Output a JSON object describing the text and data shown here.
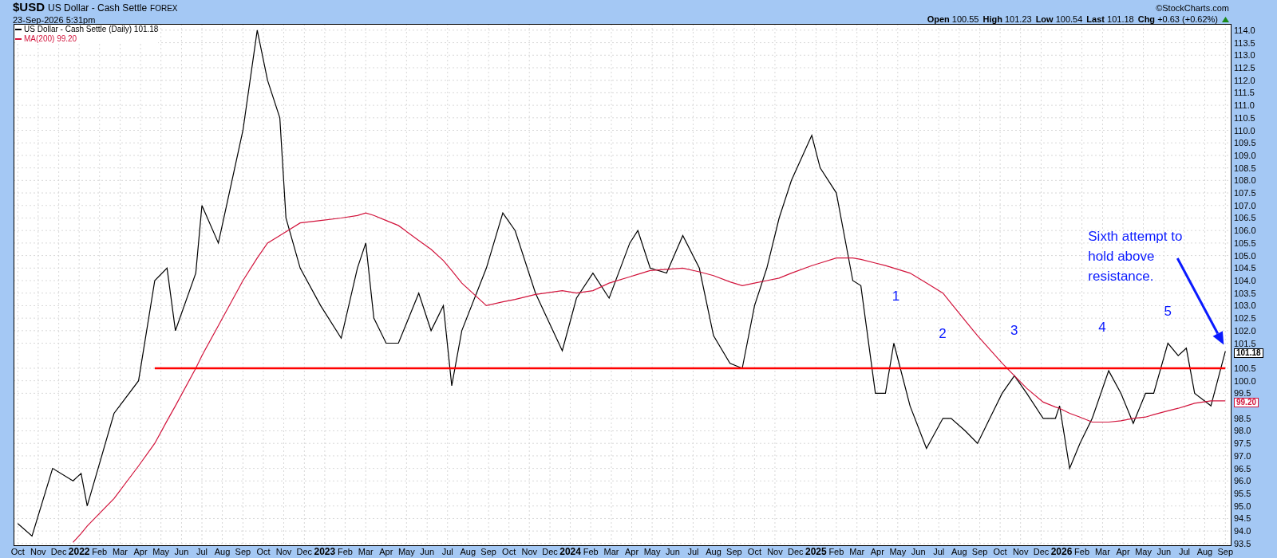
{
  "header": {
    "symbol": "$USD",
    "name": "US Dollar - Cash Settle",
    "exchange": "FOREX",
    "timestamp": "23-Sep-2026 5:31pm",
    "copyright": "©StockCharts.com",
    "quote": [
      {
        "label": "Open",
        "value": "100.55"
      },
      {
        "label": "High",
        "value": "101.23"
      },
      {
        "label": "Low",
        "value": "100.54"
      },
      {
        "label": "Last",
        "value": "101.18"
      },
      {
        "label": "Chg",
        "value": "+0.63 (+0.62%)"
      }
    ],
    "change_up": true
  },
  "legend_readings": [
    "101.18",
    "99.20"
  ],
  "price_tags": [
    "101.18",
    "99.20"
  ],
  "chart": {
    "chart_data": {
      "type": "line",
      "grid": true,
      "legend": true,
      "xlim": [
        2021.733,
        2026.692
      ],
      "ylim": [
        93.4,
        114.25
      ],
      "x": [
        2021.75,
        2021.808,
        2021.892,
        2021.975,
        2022.008,
        2022.033,
        2022.142,
        2022.242,
        2022.308,
        2022.358,
        2022.392,
        2022.475,
        2022.5,
        2022.567,
        2022.667,
        2022.725,
        2022.767,
        2022.817,
        2022.842,
        2022.9,
        2022.983,
        2023.067,
        2023.133,
        2023.167,
        2023.2,
        2023.25,
        2023.3,
        2023.383,
        2023.433,
        2023.483,
        2023.517,
        2023.558,
        2023.658,
        2023.725,
        2023.775,
        2023.858,
        2023.967,
        2024.025,
        2024.092,
        2024.158,
        2024.242,
        2024.275,
        2024.325,
        2024.392,
        2024.458,
        2024.525,
        2024.583,
        2024.65,
        2024.7,
        2024.75,
        2024.8,
        2024.85,
        2024.9,
        2024.983,
        2025.017,
        2025.083,
        2025.15,
        2025.183,
        2025.242,
        2025.283,
        2025.317,
        2025.383,
        2025.45,
        2025.517,
        2025.55,
        2025.608,
        2025.658,
        2025.708,
        2025.758,
        2025.808,
        2025.858,
        2025.925,
        2025.975,
        2025.992,
        2026.033,
        2026.075,
        2026.125,
        2026.192,
        2026.242,
        2026.292,
        2026.342,
        2026.375,
        2026.433,
        2026.475,
        2026.508,
        2026.542,
        2026.608,
        2026.667
      ],
      "series": [
        {
          "name": "US Dollar - Cash Settle (Daily)",
          "color": "#000000",
          "values": [
            94.3,
            93.8,
            96.5,
            96.0,
            96.3,
            95.0,
            98.7,
            100.0,
            104.0,
            104.5,
            102.0,
            104.3,
            107.0,
            105.5,
            110.0,
            114.0,
            112.0,
            110.5,
            106.5,
            104.5,
            103.0,
            101.7,
            104.5,
            105.5,
            102.5,
            101.5,
            101.5,
            103.5,
            102.0,
            103.0,
            99.8,
            102.0,
            104.5,
            106.7,
            106.0,
            103.5,
            101.2,
            103.3,
            104.3,
            103.3,
            105.5,
            106.0,
            104.5,
            104.3,
            105.8,
            104.5,
            101.8,
            100.7,
            100.5,
            103.0,
            104.5,
            106.5,
            108.0,
            109.8,
            108.5,
            107.5,
            104.0,
            103.8,
            99.5,
            99.5,
            101.5,
            99.0,
            97.3,
            98.5,
            98.5,
            98.0,
            97.5,
            98.5,
            99.5,
            100.2,
            99.5,
            98.5,
            98.5,
            99.0,
            96.5,
            97.5,
            98.5,
            100.4,
            99.5,
            98.3,
            99.5,
            99.5,
            101.5,
            101.0,
            101.3,
            99.5,
            99.0,
            101.18
          ]
        },
        {
          "name": "MA(200)",
          "color": "#d2143c",
          "values": [
            null,
            null,
            null,
            93.55,
            93.9,
            94.2,
            95.3,
            96.6,
            97.5,
            98.4,
            99.0,
            100.5,
            101.0,
            102.2,
            104.0,
            104.9,
            105.5,
            105.8,
            105.95,
            106.3,
            106.4,
            106.5,
            106.6,
            106.7,
            106.6,
            106.4,
            106.2,
            105.6,
            105.25,
            104.8,
            104.4,
            103.9,
            103.0,
            103.15,
            103.25,
            103.45,
            103.6,
            103.5,
            103.6,
            103.9,
            104.15,
            104.25,
            104.4,
            104.45,
            104.5,
            104.35,
            104.2,
            103.95,
            103.8,
            103.9,
            104.0,
            104.1,
            104.3,
            104.6,
            104.7,
            104.9,
            104.9,
            104.85,
            104.7,
            104.6,
            104.5,
            104.3,
            103.9,
            103.5,
            103.1,
            102.4,
            101.8,
            101.25,
            100.7,
            100.2,
            99.7,
            99.15,
            98.95,
            98.9,
            98.7,
            98.55,
            98.35,
            98.35,
            98.4,
            98.5,
            98.55,
            98.65,
            98.8,
            98.9,
            99.0,
            99.1,
            99.2,
            99.2
          ]
        },
        {
          "color": "#ff0000",
          "values": [
            null,
            null,
            null,
            null,
            null,
            null,
            null,
            null,
            100.5,
            100.5,
            100.5,
            100.5,
            100.5,
            100.5,
            100.5,
            100.5,
            100.5,
            100.5,
            100.5,
            100.5,
            100.5,
            100.5,
            100.5,
            100.5,
            100.5,
            100.5,
            100.5,
            100.5,
            100.5,
            100.5,
            100.5,
            100.5,
            100.5,
            100.5,
            100.5,
            100.5,
            100.5,
            100.5,
            100.5,
            100.5,
            100.5,
            100.5,
            100.5,
            100.5,
            100.5,
            100.5,
            100.5,
            100.5,
            100.5,
            100.5,
            100.5,
            100.5,
            100.5,
            100.5,
            100.5,
            100.5,
            100.5,
            100.5,
            100.5,
            100.5,
            100.5,
            100.5,
            100.5,
            100.5,
            100.5,
            100.5,
            100.5,
            100.5,
            100.5,
            100.5,
            100.5,
            100.5,
            100.5,
            100.5,
            100.5,
            100.5,
            100.5,
            100.5,
            100.5,
            100.5,
            100.5,
            100.5,
            100.5,
            100.5,
            100.5,
            100.5,
            100.5,
            100.5
          ]
        }
      ],
      "yticks": [
        {
          "value": 114,
          "label": "114.0"
        },
        {
          "value": 113.5,
          "label": "113.5"
        },
        {
          "value": 113,
          "label": "113.0"
        },
        {
          "value": 112.5,
          "label": "112.5"
        },
        {
          "value": 112,
          "label": "112.0"
        },
        {
          "value": 111.5,
          "label": "111.5"
        },
        {
          "value": 111,
          "label": "111.0"
        },
        {
          "value": 110.5,
          "label": "110.5"
        },
        {
          "value": 110,
          "label": "110.0"
        },
        {
          "value": 109.5,
          "label": "109.5"
        },
        {
          "value": 109,
          "label": "109.0"
        },
        {
          "value": 108.5,
          "label": "108.5"
        },
        {
          "value": 108,
          "label": "108.0"
        },
        {
          "value": 107.5,
          "label": "107.5"
        },
        {
          "value": 107,
          "label": "107.0"
        },
        {
          "value": 106.5,
          "label": "106.5"
        },
        {
          "value": 106,
          "label": "106.0"
        },
        {
          "value": 105.5,
          "label": "105.5"
        },
        {
          "value": 105,
          "label": "105.0"
        },
        {
          "value": 104.5,
          "label": "104.5"
        },
        {
          "value": 104,
          "label": "104.0"
        },
        {
          "value": 103.5,
          "label": "103.5"
        },
        {
          "value": 103,
          "label": "103.0"
        },
        {
          "value": 102.5,
          "label": "102.5"
        },
        {
          "value": 102,
          "label": "102.0"
        },
        {
          "value": 101.5,
          "label": "101.5"
        },
        {
          "value": 100.5,
          "label": "100.5"
        },
        {
          "value": 100,
          "label": "100.0"
        },
        {
          "value": 99.5,
          "label": "99.5"
        },
        {
          "value": 98.5,
          "label": "98.5"
        },
        {
          "value": 98,
          "label": "98.0"
        },
        {
          "value": 97.5,
          "label": "97.5"
        },
        {
          "value": 97,
          "label": "97.0"
        },
        {
          "value": 96.5,
          "label": "96.5"
        },
        {
          "value": 96,
          "label": "96.0"
        },
        {
          "value": 95.5,
          "label": "95.5"
        },
        {
          "value": 95,
          "label": "95.0"
        },
        {
          "value": 94.5,
          "label": "94.5"
        },
        {
          "value": 94,
          "label": "94.0"
        },
        {
          "value": 93.5,
          "label": "93.5"
        }
      ],
      "xticks": [
        {
          "value": 2021.75,
          "label": "Oct"
        },
        {
          "value": 2021.833,
          "label": "Nov"
        },
        {
          "value": 2021.917,
          "label": "Dec"
        },
        {
          "value": 2022,
          "label": "2022"
        },
        {
          "value": 2022.083,
          "label": "Feb"
        },
        {
          "value": 2022.167,
          "label": "Mar"
        },
        {
          "value": 2022.25,
          "label": "Apr"
        },
        {
          "value": 2022.333,
          "label": "May"
        },
        {
          "value": 2022.417,
          "label": "Jun"
        },
        {
          "value": 2022.5,
          "label": "Jul"
        },
        {
          "value": 2022.583,
          "label": "Aug"
        },
        {
          "value": 2022.667,
          "label": "Sep"
        },
        {
          "value": 2022.75,
          "label": "Oct"
        },
        {
          "value": 2022.833,
          "label": "Nov"
        },
        {
          "value": 2022.917,
          "label": "Dec"
        },
        {
          "value": 2023,
          "label": "2023"
        },
        {
          "value": 2023.083,
          "label": "Feb"
        },
        {
          "value": 2023.167,
          "label": "Mar"
        },
        {
          "value": 2023.25,
          "label": "Apr"
        },
        {
          "value": 2023.333,
          "label": "May"
        },
        {
          "value": 2023.417,
          "label": "Jun"
        },
        {
          "value": 2023.5,
          "label": "Jul"
        },
        {
          "value": 2023.583,
          "label": "Aug"
        },
        {
          "value": 2023.667,
          "label": "Sep"
        },
        {
          "value": 2023.75,
          "label": "Oct"
        },
        {
          "value": 2023.833,
          "label": "Nov"
        },
        {
          "value": 2023.917,
          "label": "Dec"
        },
        {
          "value": 2024,
          "label": "2024"
        },
        {
          "value": 2024.083,
          "label": "Feb"
        },
        {
          "value": 2024.167,
          "label": "Mar"
        },
        {
          "value": 2024.25,
          "label": "Apr"
        },
        {
          "value": 2024.333,
          "label": "May"
        },
        {
          "value": 2024.417,
          "label": "Jun"
        },
        {
          "value": 2024.5,
          "label": "Jul"
        },
        {
          "value": 2024.583,
          "label": "Aug"
        },
        {
          "value": 2024.667,
          "label": "Sep"
        },
        {
          "value": 2024.75,
          "label": "Oct"
        },
        {
          "value": 2024.833,
          "label": "Nov"
        },
        {
          "value": 2024.917,
          "label": "Dec"
        },
        {
          "value": 2025,
          "label": "2025"
        },
        {
          "value": 2025.083,
          "label": "Feb"
        },
        {
          "value": 2025.167,
          "label": "Mar"
        },
        {
          "value": 2025.25,
          "label": "Apr"
        },
        {
          "value": 2025.333,
          "label": "May"
        },
        {
          "value": 2025.417,
          "label": "Jun"
        },
        {
          "value": 2025.5,
          "label": "Jul"
        },
        {
          "value": 2025.583,
          "label": "Aug"
        },
        {
          "value": 2025.667,
          "label": "Sep"
        },
        {
          "value": 2025.75,
          "label": "Oct"
        },
        {
          "value": 2025.833,
          "label": "Nov"
        },
        {
          "value": 2025.917,
          "label": "Dec"
        },
        {
          "value": 2026,
          "label": "2026"
        },
        {
          "value": 2026.083,
          "label": "Feb"
        },
        {
          "value": 2026.167,
          "label": "Mar"
        },
        {
          "value": 2026.25,
          "label": "Apr"
        },
        {
          "value": 2026.333,
          "label": "May"
        },
        {
          "value": 2026.417,
          "label": "Jun"
        },
        {
          "value": 2026.5,
          "label": "Jul"
        },
        {
          "value": 2026.583,
          "label": "Aug"
        },
        {
          "value": 2026.667,
          "label": "Sep"
        }
      ],
      "annotations": [
        "1",
        "2",
        "3",
        "4",
        "5",
        "Sixth attempt to",
        "hold above",
        "resistance."
      ]
    }
  }
}
